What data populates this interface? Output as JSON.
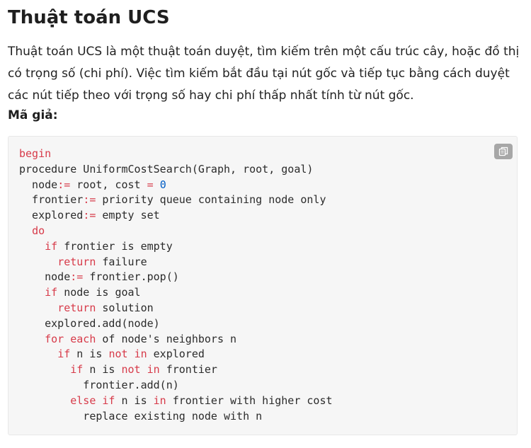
{
  "title": "Thuật toán UCS",
  "description": "Thuật toán UCS là một thuật toán duyệt, tìm kiếm trên một cấu trúc cây, hoặc đồ thị có trọng số (chi phí). Việc tìm kiếm bắt đầu tại nút gốc và tiếp tục bằng cách duyệt các nút tiếp theo với trọng số hay chi phí thấp nhất tính từ nút gốc.",
  "pseudocode_label": "Mã giả:",
  "copy_icon": "copy-icon",
  "code_lines": [
    [
      {
        "t": "begin",
        "c": "kw"
      }
    ],
    [
      {
        "t": "procedure UniformCostSearch(Graph, root, goal)"
      }
    ],
    [
      {
        "t": "  node"
      },
      {
        "t": ":=",
        "c": "kw"
      },
      {
        "t": " root, cost "
      },
      {
        "t": "=",
        "c": "kw"
      },
      {
        "t": " "
      },
      {
        "t": "0",
        "c": "num"
      }
    ],
    [
      {
        "t": "  frontier"
      },
      {
        "t": ":=",
        "c": "kw"
      },
      {
        "t": " priority queue containing node only"
      }
    ],
    [
      {
        "t": "  explored"
      },
      {
        "t": ":=",
        "c": "kw"
      },
      {
        "t": " empty set"
      }
    ],
    [
      {
        "t": "  "
      },
      {
        "t": "do",
        "c": "kw"
      }
    ],
    [
      {
        "t": "    "
      },
      {
        "t": "if",
        "c": "kw"
      },
      {
        "t": " frontier is empty"
      }
    ],
    [
      {
        "t": "      "
      },
      {
        "t": "return",
        "c": "kw"
      },
      {
        "t": " failure"
      }
    ],
    [
      {
        "t": "    node"
      },
      {
        "t": ":=",
        "c": "kw"
      },
      {
        "t": " frontier.pop()"
      }
    ],
    [
      {
        "t": "    "
      },
      {
        "t": "if",
        "c": "kw"
      },
      {
        "t": " node is goal"
      }
    ],
    [
      {
        "t": "      "
      },
      {
        "t": "return",
        "c": "kw"
      },
      {
        "t": " solution"
      }
    ],
    [
      {
        "t": "    explored.add(node)"
      }
    ],
    [
      {
        "t": "    "
      },
      {
        "t": "for",
        "c": "kw"
      },
      {
        "t": " "
      },
      {
        "t": "each",
        "c": "kw"
      },
      {
        "t": " of node's neighbors n"
      }
    ],
    [
      {
        "t": "      "
      },
      {
        "t": "if",
        "c": "kw"
      },
      {
        "t": " n is "
      },
      {
        "t": "not",
        "c": "kw"
      },
      {
        "t": " "
      },
      {
        "t": "in",
        "c": "kw"
      },
      {
        "t": " explored"
      }
    ],
    [
      {
        "t": "        "
      },
      {
        "t": "if",
        "c": "kw"
      },
      {
        "t": " n is "
      },
      {
        "t": "not",
        "c": "kw"
      },
      {
        "t": " "
      },
      {
        "t": "in",
        "c": "kw"
      },
      {
        "t": " frontier"
      }
    ],
    [
      {
        "t": "          frontier.add(n)"
      }
    ],
    [
      {
        "t": "        "
      },
      {
        "t": "else",
        "c": "kw"
      },
      {
        "t": " "
      },
      {
        "t": "if",
        "c": "kw"
      },
      {
        "t": " n is "
      },
      {
        "t": "in",
        "c": "kw"
      },
      {
        "t": " frontier with higher cost"
      }
    ],
    [
      {
        "t": "          replace existing node with n"
      }
    ]
  ]
}
